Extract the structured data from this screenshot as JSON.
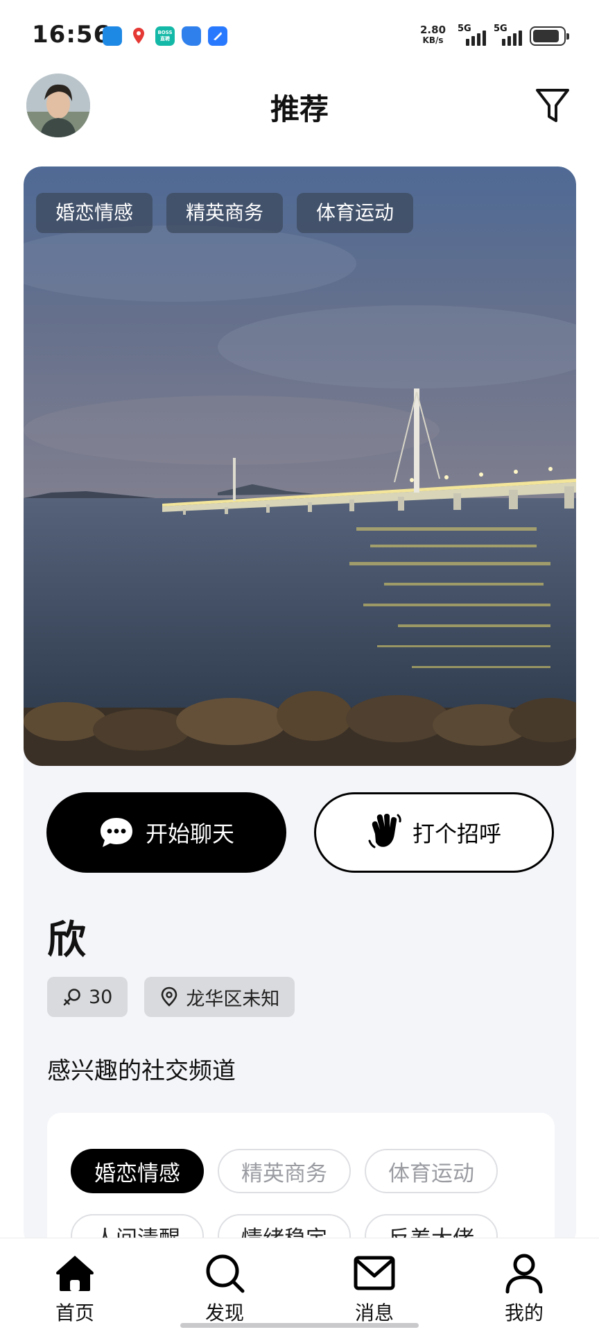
{
  "status_bar": {
    "time": "16:56",
    "net_speed_value": "2.80",
    "net_speed_unit": "KB/s",
    "signal_1_label": "5G",
    "signal_2_label": "5G",
    "app_icons": [
      {
        "name": "blue-chat-app-icon",
        "color": "#1e88e5"
      },
      {
        "name": "maps-app-icon",
        "color": "#e53935"
      },
      {
        "name": "boss-zhipin-app-icon",
        "color": "#14b8a6",
        "text": "BOSS直聘"
      },
      {
        "name": "files-app-icon",
        "color": "#2f80ed"
      },
      {
        "name": "blue-app-icon",
        "color": "#2979ff"
      }
    ]
  },
  "header": {
    "title": "推荐"
  },
  "profile": {
    "photo_tags": [
      "婚恋情感",
      "精英商务",
      "体育运动"
    ],
    "chat_button": "开始聊天",
    "greet_button": "打个招呼",
    "name": "欣",
    "age": "30",
    "location": "龙华区未知"
  },
  "channels": {
    "section_title": "感兴趣的社交频道",
    "row1": [
      "婚恋情感",
      "精英商务",
      "体育运动"
    ],
    "row2": [
      "人间清醒",
      "情绪稳定",
      "反差大佬"
    ],
    "active": "婚恋情感"
  },
  "nav": {
    "items": [
      {
        "label": "首页",
        "icon": "home-icon",
        "active": true
      },
      {
        "label": "发现",
        "icon": "search-icon"
      },
      {
        "label": "消息",
        "icon": "mail-icon"
      },
      {
        "label": "我的",
        "icon": "person-icon"
      }
    ]
  },
  "colors": {
    "accent": "#000000",
    "card_bg": "#f4f5f9",
    "tag_bg": "#3c485c"
  }
}
